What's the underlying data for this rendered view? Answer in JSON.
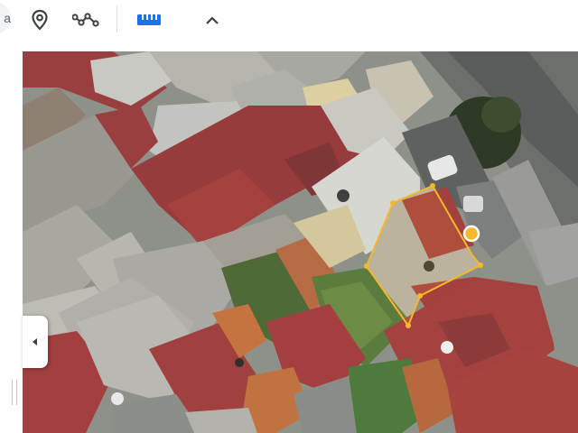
{
  "toolbar": {
    "search_fragment": "a",
    "tools": [
      {
        "icon": "map-pin-icon",
        "label": ""
      },
      {
        "icon": "path-icon",
        "label": ""
      },
      {
        "icon": "ruler-icon",
        "label": "",
        "active": true
      },
      {
        "icon": "chevron-up-icon",
        "label": ""
      }
    ]
  },
  "map": {
    "view": "satellite",
    "measure_color": "#f5b829",
    "measure_area_polygon": [
      [
        0.62,
        0.55
      ],
      [
        0.67,
        0.39
      ],
      [
        0.73,
        0.36
      ],
      [
        0.77,
        0.48
      ],
      [
        0.83,
        0.56
      ],
      [
        0.72,
        0.62
      ],
      [
        0.69,
        0.72
      ]
    ]
  },
  "colors": {
    "accent": "#1a73e8",
    "roof_red": "#9b3d40",
    "roof_gray": "#b9b9b4",
    "vegetation": "#4d6b35"
  },
  "panel": {
    "collapse_icon": "chevron-left-icon"
  }
}
